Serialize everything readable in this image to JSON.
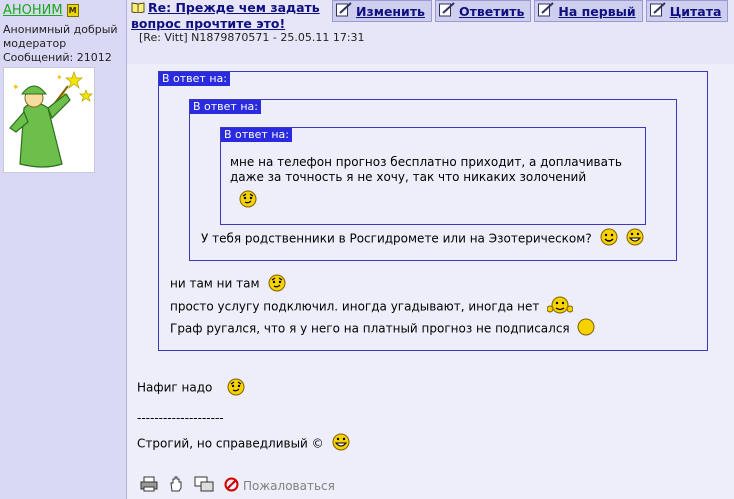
{
  "author": {
    "name": "АНОНИМ",
    "badge": "М",
    "title": "Анонимный добрый модератор",
    "messages": "Сообщений: 21012"
  },
  "post": {
    "topic": "Re: Прежде чем задать вопрос прочтите это!",
    "reply_to": "[Re: Vitt]",
    "id_date": "N1879870571 - 25.05.11 17:31"
  },
  "actions": {
    "edit": "Изменить",
    "reply": "Ответить",
    "to_first": "На первый",
    "quote": "Цитата"
  },
  "quote_label": "В ответ на:",
  "quotes": {
    "level3_line1": "мне на телефон прогноз бесплатно приходит, а доплачивать",
    "level3_line2": "даже за точность я не хочу, так что никаких золочений",
    "level2_line": "У тебя родственники в Росгидромете или на Эзотерическом?",
    "level1_line1": "ни там ни там",
    "level1_line2": "просто услугу подключил. иногда угадывают, иногда нет",
    "level1_line3": "Граф ругался, что я у него на платный прогноз не подписался"
  },
  "body": {
    "text": "Нафиг надо",
    "separator": "--------------------",
    "signature": "Строгий, но справедливый ©"
  },
  "footer": {
    "complain": "Пожаловаться"
  }
}
